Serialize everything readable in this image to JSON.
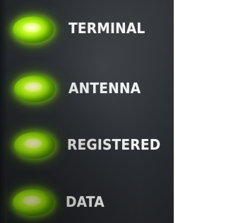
{
  "indicators": [
    {
      "label": "TERMINAL",
      "state": "on",
      "color": "#9be20a"
    },
    {
      "label": "ANTENNA",
      "state": "on",
      "color": "#9be20a"
    },
    {
      "label": "REGISTERED",
      "state": "on",
      "color": "#9be20a"
    },
    {
      "label": "DATA",
      "state": "on",
      "color": "#9be20a"
    }
  ],
  "panel_color": "#2a2d31",
  "label_color": "#f2f4f4"
}
